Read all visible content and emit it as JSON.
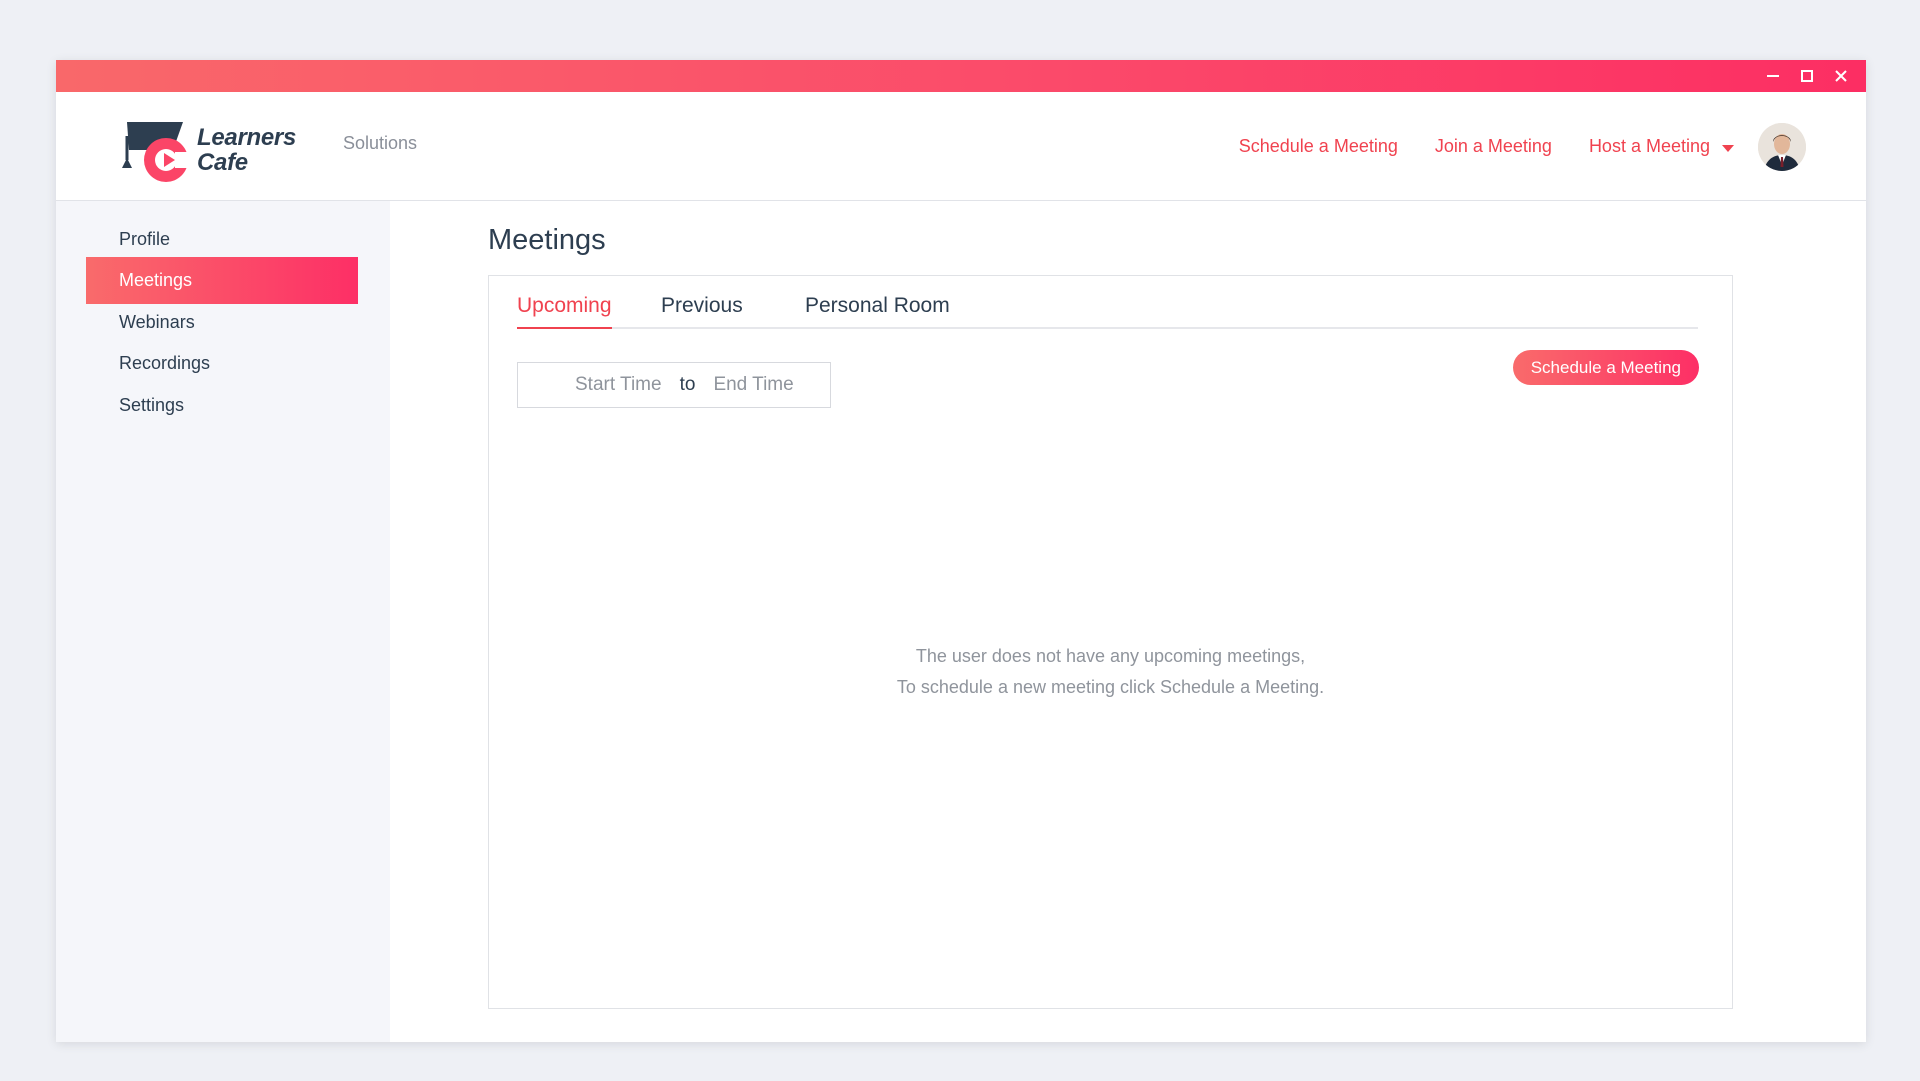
{
  "app": {
    "logo_line1": "Learners",
    "logo_line2": "Cafe",
    "solutions": "Solutions"
  },
  "window_controls": [
    "minimize-icon",
    "maximize-icon",
    "close-icon"
  ],
  "header_nav": {
    "schedule": "Schedule a Meeting",
    "join": "Join a Meeting",
    "host": "Host a Meeting"
  },
  "sidebar": {
    "items": [
      {
        "label": "Profile",
        "active": false
      },
      {
        "label": "Meetings",
        "active": true
      },
      {
        "label": "Webinars",
        "active": false
      },
      {
        "label": "Recordings",
        "active": false
      },
      {
        "label": "Settings",
        "active": false
      }
    ]
  },
  "main": {
    "title": "Meetings",
    "tabs": [
      {
        "label": "Upcoming",
        "active": true
      },
      {
        "label": "Previous",
        "active": false
      },
      {
        "label": "Personal Room",
        "active": false
      }
    ],
    "date_range": {
      "start_placeholder": "Start Time",
      "separator": "to",
      "end_placeholder": "End Time"
    },
    "schedule_button": "Schedule a Meeting",
    "empty_line1": "The user does not have any upcoming meetings,",
    "empty_line2": "To schedule a new meeting click Schedule a Meeting."
  },
  "colors": {
    "accent": "#f0424f",
    "gradient_start": "#f96b6b",
    "gradient_end": "#fd2f66",
    "text_dark": "#2d3e50",
    "text_muted": "#8f949c"
  }
}
